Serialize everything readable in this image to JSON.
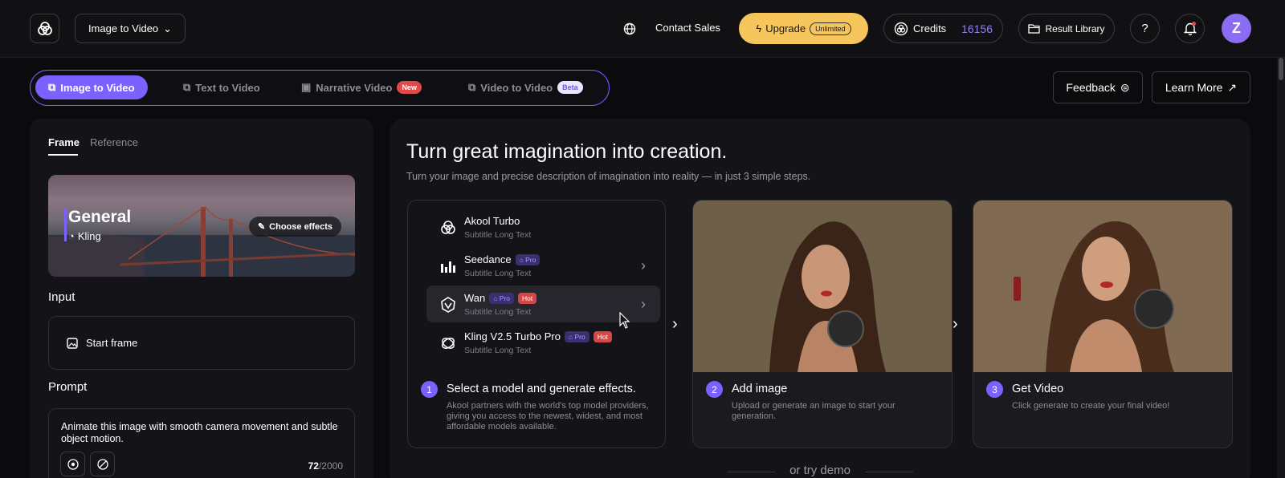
{
  "topbar": {
    "mode_select": "Image to Video",
    "contact_sales": "Contact Sales",
    "upgrade_label": "Upgrade",
    "upgrade_badge": "Unlimited",
    "credits_label": "Credits",
    "credits_value": "16156",
    "result_library": "Result Library",
    "help": "?",
    "avatar_letter": "Z"
  },
  "mode_tabs": [
    {
      "label": "Image to Video",
      "active": true
    },
    {
      "label": "Text to Video"
    },
    {
      "label": "Narrative Video",
      "badge": "New"
    },
    {
      "label": "Video to Video",
      "badge": "Beta"
    }
  ],
  "actions": {
    "feedback": "Feedback",
    "learn_more": "Learn More"
  },
  "left": {
    "tabs": {
      "frame": "Frame",
      "reference": "Reference"
    },
    "effect": {
      "title": "General",
      "provider": "Kling",
      "choose": "Choose effects"
    },
    "input_label": "Input",
    "start_frame": "Start frame",
    "prompt_label": "Prompt",
    "prompt_text": "Animate this image with smooth camera movement and subtle object motion.",
    "prompt_count": "72",
    "prompt_max": "/2000"
  },
  "main": {
    "title": "Turn great imagination into creation.",
    "subtitle": "Turn your image and precise description of imagination into reality — in just 3 simple steps.",
    "models": [
      {
        "name": "Akool Turbo",
        "subtitle": "Subtitle Long Text"
      },
      {
        "name": "Seedance",
        "subtitle": "Subtitle Long Text",
        "pro": "Pro"
      },
      {
        "name": "Wan",
        "subtitle": "Subtitle Long Text",
        "pro": "Pro",
        "hot": "Hot"
      },
      {
        "name": "Kling V2.5 Turbo Pro",
        "subtitle": "Subtitle Long Text",
        "pro": "Pro",
        "hot": "Hot"
      }
    ],
    "steps": [
      {
        "num": "1",
        "title": "Select a model and generate effects.",
        "desc": "Akool partners with the world's top model providers, giving you access to the newest, widest, and most affordable models available."
      },
      {
        "num": "2",
        "title": "Add image",
        "desc": "Upload or generate an image to start your generation."
      },
      {
        "num": "3",
        "title": "Get Video",
        "desc": "Click generate to create your final video!"
      }
    ],
    "demo": "or try demo"
  },
  "colors": {
    "accent": "#7b61ff",
    "upgrade": "#f6c55c",
    "credits": "#8f7dfa",
    "hot": "#d84545"
  }
}
